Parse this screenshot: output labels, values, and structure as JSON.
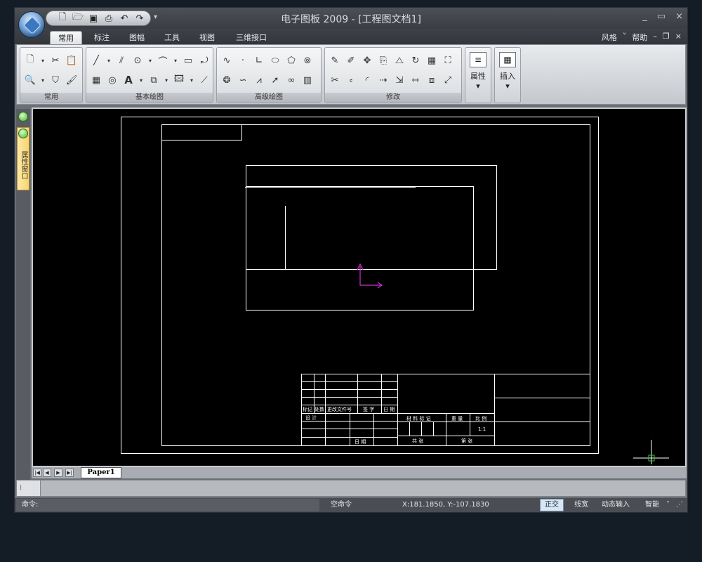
{
  "window": {
    "title": "电子图板 2009 - [工程图文档1]",
    "controls": [
      "_",
      "▭",
      "×"
    ]
  },
  "quick_access": [
    "new-doc",
    "open",
    "save",
    "print",
    "undo",
    "redo"
  ],
  "tabs": [
    {
      "label": "常用",
      "active": true
    },
    {
      "label": "标注"
    },
    {
      "label": "图幅"
    },
    {
      "label": "工具"
    },
    {
      "label": "视图"
    },
    {
      "label": "三维接口"
    }
  ],
  "tab_right": {
    "style": "风格",
    "help": "帮助"
  },
  "ribbon": {
    "groups": [
      {
        "label": "常用"
      },
      {
        "label": "基本绘图"
      },
      {
        "label": "高级绘图"
      },
      {
        "label": "修改"
      }
    ],
    "properties_label": "属性",
    "insert_label": "插入"
  },
  "side_panel": {
    "label": "属性窗口"
  },
  "drawing": {
    "title_block": {
      "row_headers": [
        "标记",
        "处数",
        "更改文件号",
        "签 字",
        "日 期"
      ],
      "design": "设 计",
      "date": "日 期",
      "material_mark": "材 料 标 记",
      "weight": "重 量",
      "scale": "比 例",
      "scale_value": "1:1",
      "sheets": "共   张",
      "sheet_no": "第   张"
    }
  },
  "sheet_tabs": {
    "active": "Paper1"
  },
  "status": {
    "command_prompt": "命令:",
    "command_state": "空命令",
    "coords": "X:181.1850, Y:-107.1830",
    "ortho": "正交",
    "lineweight": "线宽",
    "dynamic_input": "动态输入",
    "smart": "智能"
  },
  "colors": {
    "canvas": "#000000",
    "drawing_lines": "#ffffff",
    "ucs": "#cc33cc",
    "cursor": "#ffffff"
  }
}
